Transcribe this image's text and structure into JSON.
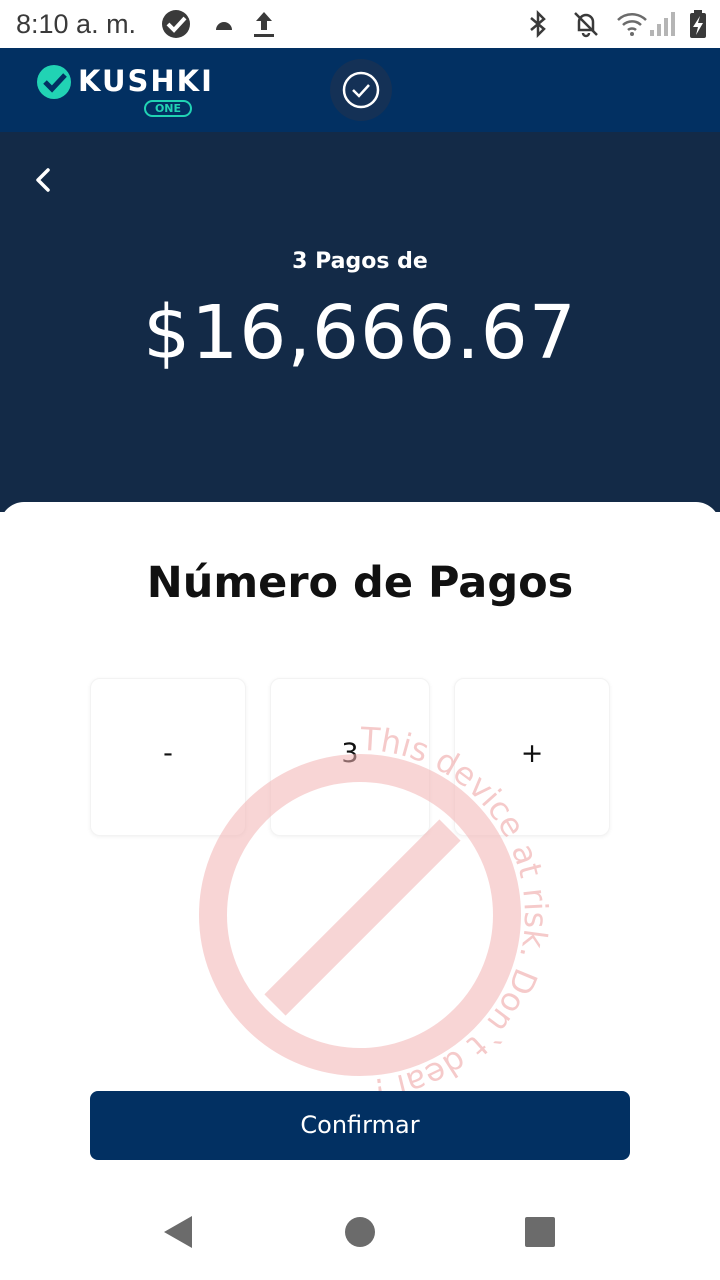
{
  "status_bar": {
    "time": "8:10 a. m.",
    "icons": [
      "kushki-app-icon",
      "android-icon",
      "upload-icon",
      "bluetooth-icon",
      "notifications-off-icon",
      "wifi-icon",
      "signal-icon",
      "battery-charging-icon"
    ]
  },
  "header": {
    "logo_text": "KUSHKI",
    "logo_badge": "ONE",
    "colors": {
      "primary": "#023062",
      "accent": "#21d3b4"
    }
  },
  "summary": {
    "label": "3 Pagos de",
    "amount": "$16,666.67",
    "background": "#132a47"
  },
  "sheet": {
    "title": "Número de Pagos",
    "stepper": {
      "decrement_label": "-",
      "value": "3",
      "increment_label": "+"
    },
    "watermark_text": "This device at risk. Don`t deal !",
    "confirm_label": "Confirmar"
  },
  "nav_bar": {
    "icons": [
      "back-triangle-icon",
      "home-circle-icon",
      "recents-square-icon"
    ]
  }
}
